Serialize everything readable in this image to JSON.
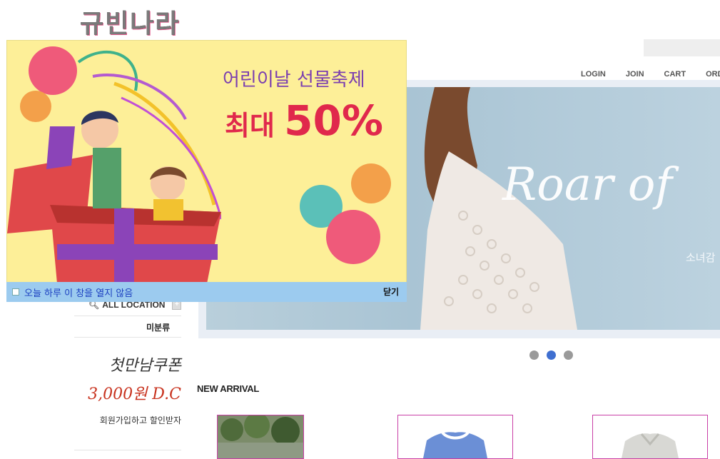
{
  "logo": {
    "text": "규빈나라"
  },
  "top_nav": {
    "items": [
      "LOGIN",
      "JOIN",
      "CART",
      "ORD"
    ]
  },
  "hero": {
    "title": "Roar of",
    "subtitle": "소녀감"
  },
  "slider": {
    "dots": 3,
    "active_index": 1,
    "active_color": "#3f6fd0",
    "inactive_color": "#9a9a9a"
  },
  "sidebar": {
    "location_label": "ALL LOCATION",
    "category": "미분류",
    "coupon": {
      "line1": "첫만남쿠폰",
      "line2": "3,000원 D.C",
      "line3": "회원가입하고 할인받자"
    }
  },
  "new_arrival": {
    "title": "NEW ARRIVAL"
  },
  "popup": {
    "headline": "어린이날 선물축제",
    "offer_prefix": "최대",
    "offer_value": "50%",
    "checkbox_label": "오늘 하루 이 창을 열지 않음",
    "close_label": "닫기"
  },
  "colors": {
    "popup_bg": "#fdef98",
    "popup_bar": "#9ccbef",
    "product_border": "#c93fa6",
    "accent_red": "#e0284c",
    "accent_purple": "#7b3fb0"
  }
}
